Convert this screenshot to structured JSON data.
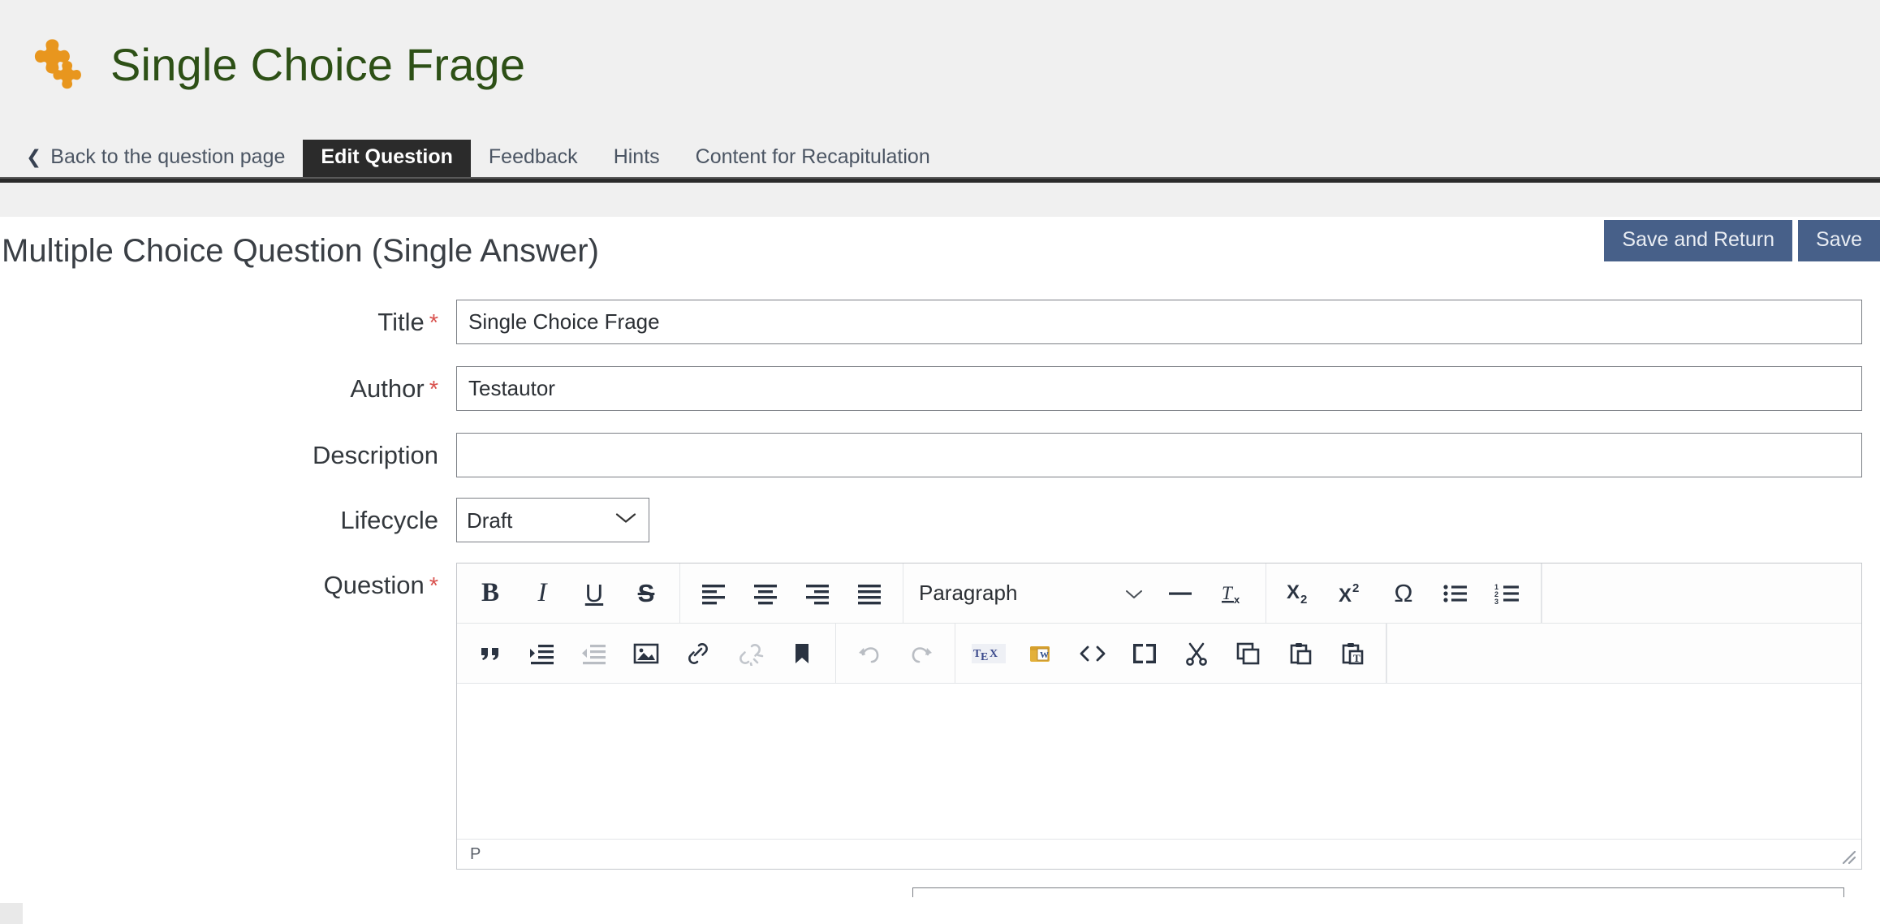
{
  "header": {
    "icon": "puzzle-piece-icon",
    "title": "Single Choice Frage",
    "title_color": "#2d5016",
    "icon_color": "#e8961e"
  },
  "tabs": {
    "back_link": "Back to the question page",
    "back_chevron": "❮",
    "items": [
      {
        "label": "Edit Question",
        "active": true
      },
      {
        "label": "Feedback",
        "active": false
      },
      {
        "label": "Hints",
        "active": false
      },
      {
        "label": "Content for Recapitulation",
        "active": false
      }
    ]
  },
  "section": {
    "title": "Multiple Choice Question (Single Answer)",
    "buttons": {
      "save_and_return": "Save and Return",
      "save": "Save"
    },
    "button_color": "#476089"
  },
  "form": {
    "required_marker": "*",
    "title": {
      "label": "Title",
      "value": "Single Choice Frage",
      "placeholder": "",
      "required": true
    },
    "author": {
      "label": "Author",
      "value": "Testautor",
      "placeholder": "",
      "required": true
    },
    "description": {
      "label": "Description",
      "value": "",
      "placeholder": "",
      "required": false
    },
    "lifecycle": {
      "label": "Lifecycle",
      "value": "Draft",
      "options": [
        "Draft"
      ],
      "required": false
    },
    "question": {
      "label": "Question",
      "required": true,
      "content": ""
    }
  },
  "editor": {
    "paragraph_style": "Paragraph",
    "status_path": "P",
    "toolbar_row1": [
      {
        "name": "bold-icon",
        "title": "Bold"
      },
      {
        "name": "italic-icon",
        "title": "Italic"
      },
      {
        "name": "underline-icon",
        "title": "Underline"
      },
      {
        "name": "strikethrough-icon",
        "title": "Strikethrough"
      },
      {
        "name": "align-left-icon",
        "title": "Align left"
      },
      {
        "name": "align-center-icon",
        "title": "Align center"
      },
      {
        "name": "align-right-icon",
        "title": "Align right"
      },
      {
        "name": "align-justify-icon",
        "title": "Justify"
      },
      {
        "name": "paragraph-style-select",
        "title": "Paragraph"
      },
      {
        "name": "horizontal-rule-icon",
        "title": "Horizontal line"
      },
      {
        "name": "remove-format-icon",
        "title": "Clear formatting"
      },
      {
        "name": "subscript-icon",
        "title": "Subscript"
      },
      {
        "name": "superscript-icon",
        "title": "Superscript"
      },
      {
        "name": "special-character-icon",
        "title": "Special character"
      },
      {
        "name": "bulleted-list-icon",
        "title": "Bulleted list"
      },
      {
        "name": "numbered-list-icon",
        "title": "Numbered list"
      }
    ],
    "toolbar_row2": [
      {
        "name": "blockquote-icon",
        "title": "Blockquote"
      },
      {
        "name": "indent-icon",
        "title": "Increase indent"
      },
      {
        "name": "outdent-icon",
        "title": "Decrease indent",
        "disabled": true
      },
      {
        "name": "insert-image-icon",
        "title": "Insert image"
      },
      {
        "name": "insert-link-icon",
        "title": "Insert link"
      },
      {
        "name": "unlink-icon",
        "title": "Remove link",
        "disabled": true
      },
      {
        "name": "anchor-icon",
        "title": "Anchor"
      },
      {
        "name": "undo-icon",
        "title": "Undo",
        "disabled": true
      },
      {
        "name": "redo-icon",
        "title": "Redo",
        "disabled": true
      },
      {
        "name": "tex-icon",
        "title": "TeX"
      },
      {
        "name": "paste-from-word-icon",
        "title": "Paste from Word"
      },
      {
        "name": "source-code-icon",
        "title": "Source code"
      },
      {
        "name": "fullscreen-icon",
        "title": "Fullscreen"
      },
      {
        "name": "cut-icon",
        "title": "Cut"
      },
      {
        "name": "copy-icon",
        "title": "Copy"
      },
      {
        "name": "paste-icon",
        "title": "Paste"
      },
      {
        "name": "paste-as-text-icon",
        "title": "Paste as plain text"
      }
    ]
  }
}
